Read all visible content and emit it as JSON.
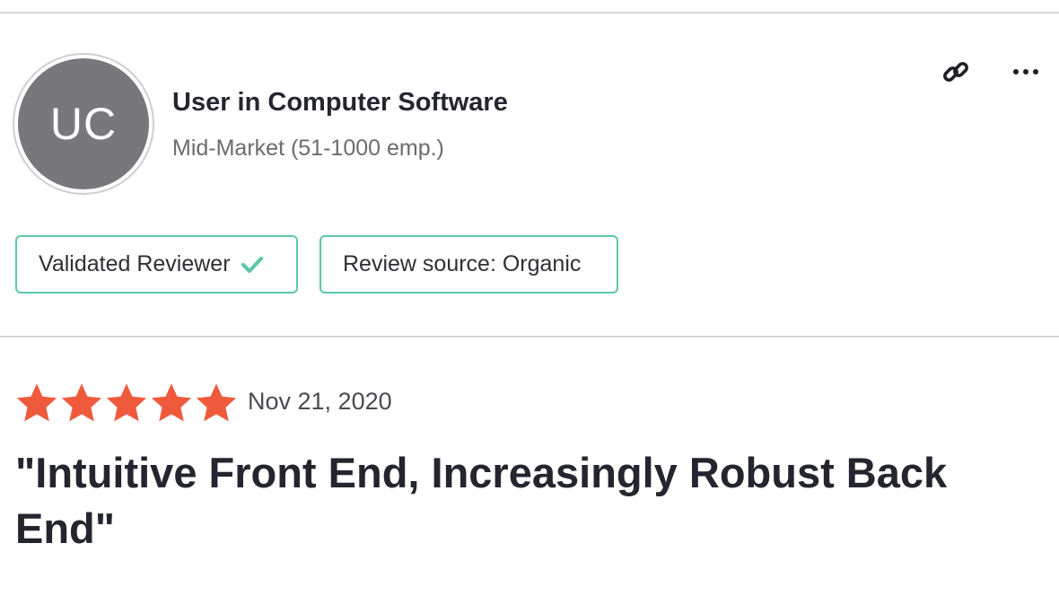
{
  "reviewer": {
    "initials": "UC",
    "name": "User in Computer Software",
    "segment": "Mid-Market (51-1000 emp.)"
  },
  "icons": {
    "link": "link-icon",
    "more": "more-options-icon",
    "check": "checkmark-icon",
    "star": "star-icon"
  },
  "badges": {
    "validated_label": "Validated Reviewer",
    "source_label": "Review source: Organic"
  },
  "review": {
    "rating": 5,
    "max_rating": 5,
    "date": "Nov 21, 2020",
    "title": "\"Intuitive Front End, Increasingly Robust Back End\""
  },
  "colors": {
    "star": "#ef5a3c",
    "badge_border": "#5cc8a7",
    "check": "#5cc8a7",
    "avatar_bg": "#78787c"
  }
}
